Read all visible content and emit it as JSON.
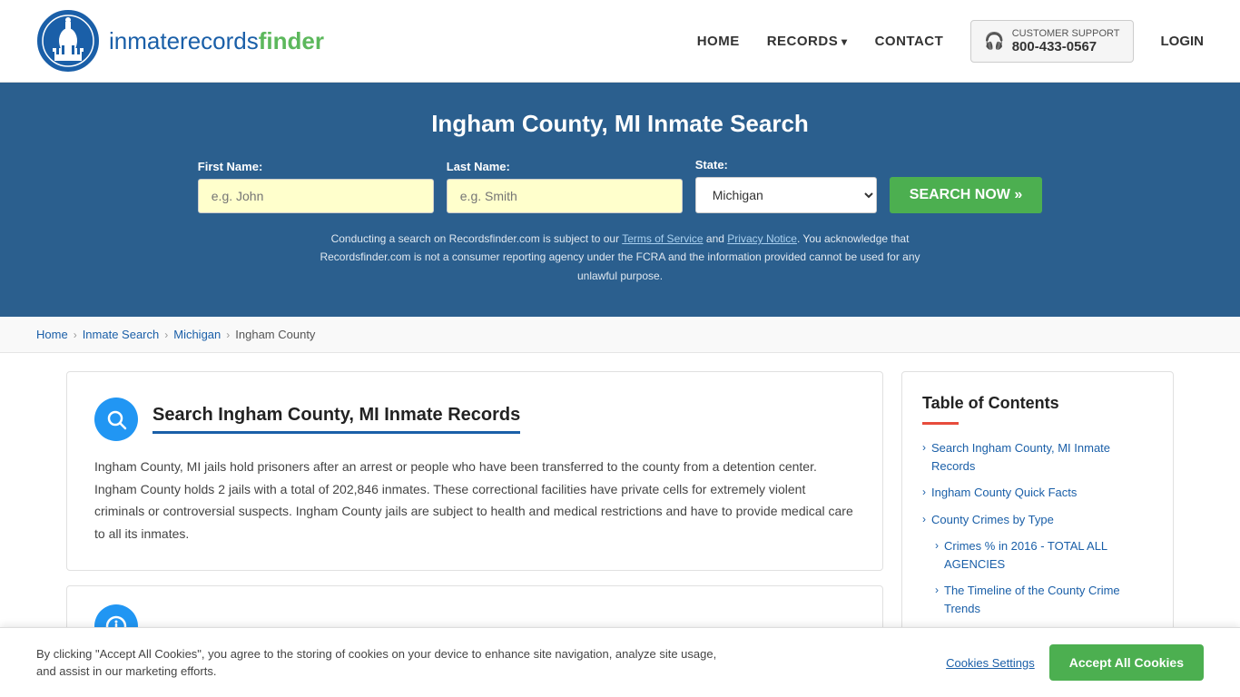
{
  "site": {
    "logo_text_part1": "inmaterecords",
    "logo_text_part2": "finder"
  },
  "nav": {
    "home_label": "HOME",
    "records_label": "RECORDS",
    "contact_label": "CONTACT",
    "support_label": "CUSTOMER SUPPORT",
    "support_number": "800-433-0567",
    "login_label": "LOGIN"
  },
  "hero": {
    "title": "Ingham County, MI Inmate Search",
    "first_name_label": "First Name:",
    "first_name_placeholder": "e.g. John",
    "last_name_label": "Last Name:",
    "last_name_placeholder": "e.g. Smith",
    "state_label": "State:",
    "state_value": "Michigan",
    "search_btn_label": "SEARCH NOW »",
    "disclaimer": "Conducting a search on Recordsfinder.com is subject to our Terms of Service and Privacy Notice. You acknowledge that Recordsfinder.com is not a consumer reporting agency under the FCRA and the information provided cannot be used for any unlawful purpose.",
    "disclaimer_tos": "Terms of Service",
    "disclaimer_privacy": "Privacy Notice"
  },
  "breadcrumb": {
    "home": "Home",
    "inmate_search": "Inmate Search",
    "michigan": "Michigan",
    "ingham_county": "Ingham County"
  },
  "main_card": {
    "title": "Search Ingham County, MI Inmate Records",
    "body": "Ingham County, MI jails hold prisoners after an arrest or people who have been transferred to the county from a detention center. Ingham County holds 2 jails with a total of 202,846 inmates. These correctional facilities have private cells for extremely violent criminals or controversial suspects. Ingham County jails are subject to health and medical restrictions and have to provide medical care to all its inmates."
  },
  "toc": {
    "title": "Table of Contents",
    "items": [
      {
        "label": "Search Ingham County, MI Inmate Records",
        "sub": false
      },
      {
        "label": "Ingham County Quick Facts",
        "sub": false
      },
      {
        "label": "County Crimes by Type",
        "sub": false
      },
      {
        "label": "Crimes % in 2016 - TOTAL ALL AGENCIES",
        "sub": true
      },
      {
        "label": "The Timeline of the County Crime Trends",
        "sub": true
      }
    ]
  },
  "cookie_banner": {
    "text": "By clicking \"Accept All Cookies\", you agree to the storing of cookies on your device to enhance site navigation, analyze site usage, and assist in our marketing efforts.",
    "settings_label": "Cookies Settings",
    "accept_label": "Accept All Cookies"
  }
}
